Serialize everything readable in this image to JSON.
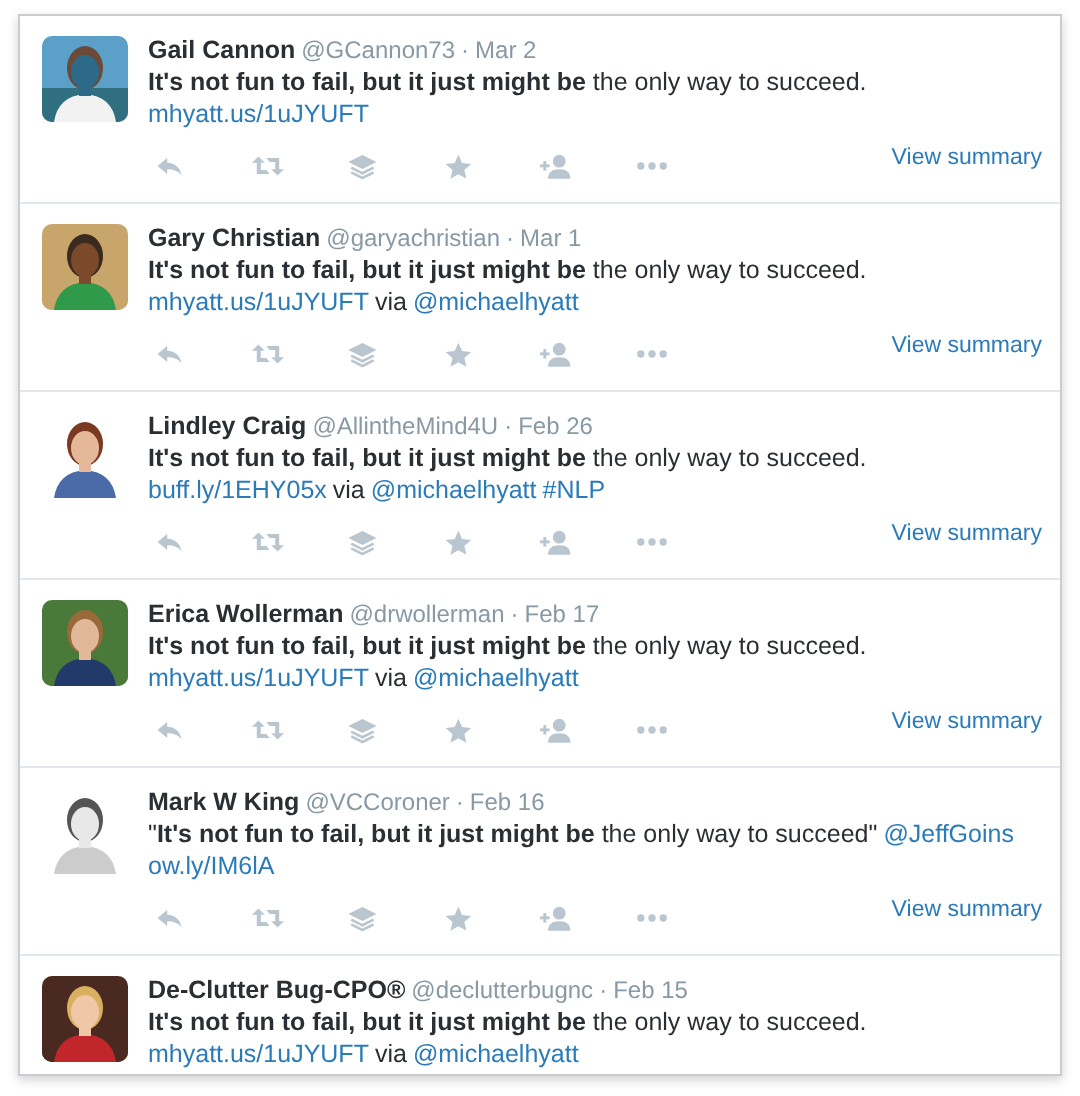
{
  "separator": "·",
  "tweets": [
    {
      "name": "Gail Cannon",
      "handle": "@GCannon73",
      "date": "Mar 2",
      "lines": [
        [
          {
            "kind": "text",
            "text": "**It's not fun to fail, but it just might be** the only way to succeed."
          }
        ],
        [
          {
            "kind": "link",
            "text": "mhyatt.us/1uJYUFT"
          }
        ]
      ],
      "summary": "View summary"
    },
    {
      "name": "Gary Christian",
      "handle": "@garyachristian",
      "date": "Mar 1",
      "lines": [
        [
          {
            "kind": "text",
            "text": "**It's not fun to fail, but it just might be** the only way to succeed."
          }
        ],
        [
          {
            "kind": "link",
            "text": "mhyatt.us/1uJYUFT"
          },
          {
            "kind": "text",
            "text": "via"
          },
          {
            "kind": "link",
            "text": "@michaelhyatt"
          }
        ]
      ],
      "summary": "View summary"
    },
    {
      "name": "Lindley Craig",
      "handle": "@AllintheMind4U",
      "date": "Feb 26",
      "lines": [
        [
          {
            "kind": "text",
            "text": "**It's not fun to fail, but it just might be** the only way to succeed."
          }
        ],
        [
          {
            "kind": "link",
            "text": "buff.ly/1EHY05x"
          },
          {
            "kind": "text",
            "text": "via"
          },
          {
            "kind": "link",
            "text": "@michaelhyatt"
          },
          {
            "kind": "link",
            "text": "#NLP"
          }
        ]
      ],
      "summary": "View summary"
    },
    {
      "name": "Erica Wollerman",
      "handle": "@drwollerman",
      "date": "Feb 17",
      "lines": [
        [
          {
            "kind": "text",
            "text": "**It's not fun to fail, but it just might be** the only way to succeed."
          }
        ],
        [
          {
            "kind": "link",
            "text": "mhyatt.us/1uJYUFT"
          },
          {
            "kind": "text",
            "text": "via"
          },
          {
            "kind": "link",
            "text": "@michaelhyatt"
          }
        ]
      ],
      "summary": "View summary"
    },
    {
      "name": "Mark W King",
      "handle": "@VCCoroner",
      "date": "Feb 16",
      "lines": [
        [
          {
            "kind": "text",
            "text": "\"**It's not fun to fail, but it just might be** the only way to succeed\""
          },
          {
            "kind": "link",
            "text": "@JeffGoins"
          }
        ],
        [
          {
            "kind": "link",
            "text": "ow.ly/IM6lA"
          }
        ]
      ],
      "summary": "View summary"
    },
    {
      "name": "De-Clutter Bug-CPO®",
      "handle": "@declutterbugnc",
      "date": "Feb 15",
      "lines": [
        [
          {
            "kind": "text",
            "text": "**It's not fun to fail, but it just might be** the only way to succeed."
          }
        ],
        [
          {
            "kind": "link",
            "text": "mhyatt.us/1uJYUFT"
          },
          {
            "kind": "text",
            "text": "via"
          },
          {
            "kind": "link",
            "text": "@michaelhyatt"
          }
        ]
      ]
    }
  ]
}
